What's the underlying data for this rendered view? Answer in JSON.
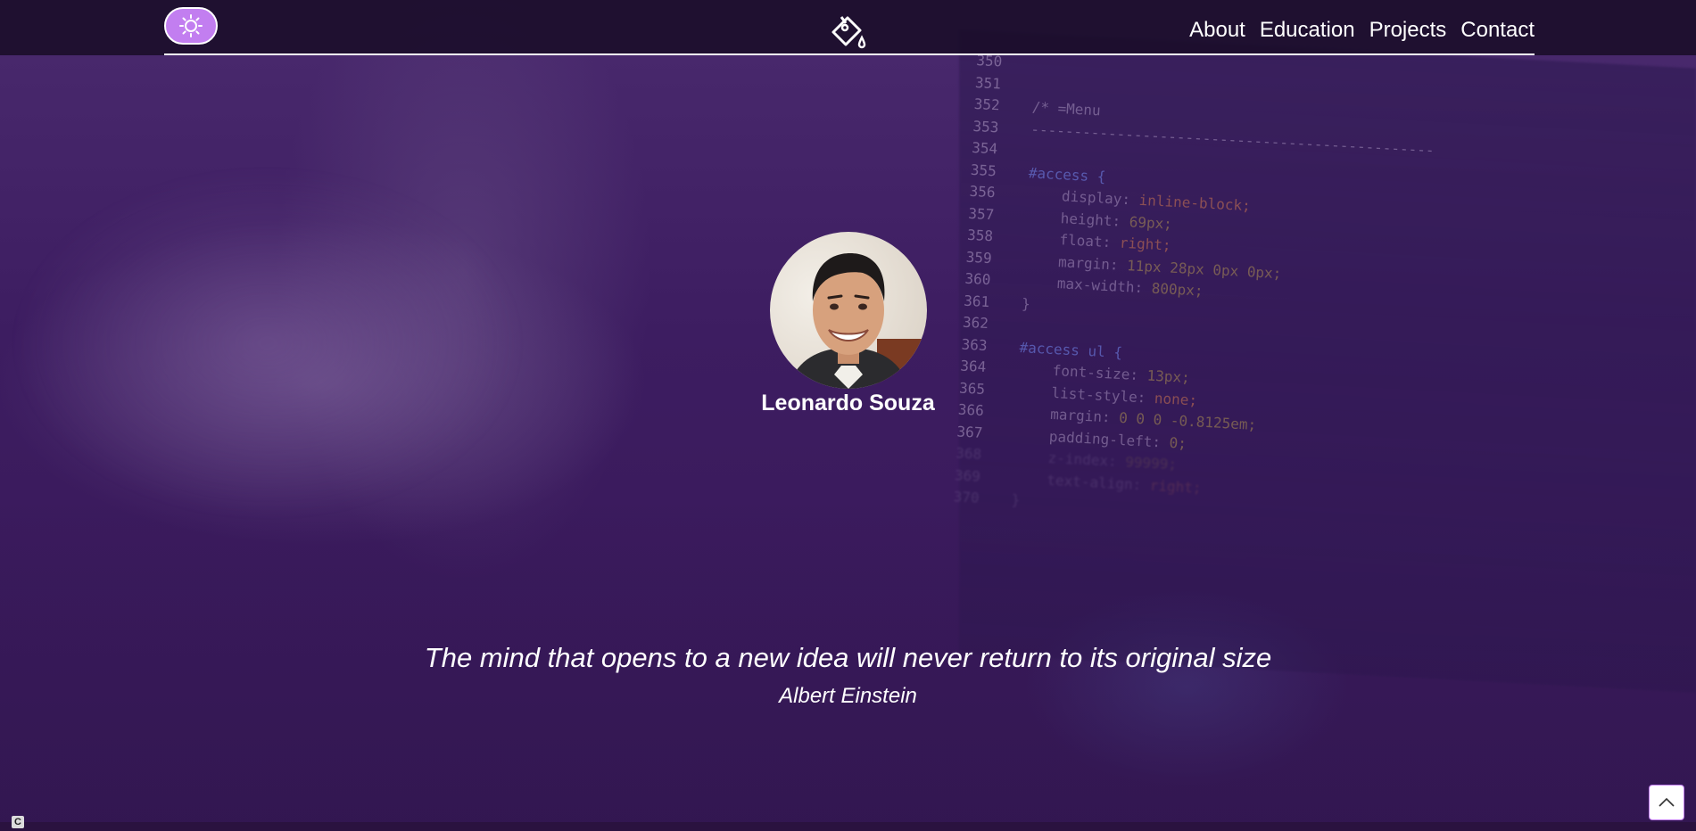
{
  "header": {
    "theme_toggle_icon": "sun-icon",
    "logo_icon": "paint-bucket-icon",
    "nav": [
      {
        "label": "About"
      },
      {
        "label": "Education"
      },
      {
        "label": "Projects"
      },
      {
        "label": "Contact"
      }
    ]
  },
  "profile": {
    "name": "Leonardo Souza"
  },
  "quote": {
    "text": "The mind that opens to a new idea will never return to its original size",
    "author": "Albert Einstein"
  },
  "background_code": [
    {
      "ln": "350",
      "text": ""
    },
    {
      "ln": "351",
      "text": ""
    },
    {
      "ln": "352",
      "text": "/* =Menu"
    },
    {
      "ln": "353",
      "text": "-----------------------------------------------"
    },
    {
      "ln": "354",
      "text": ""
    },
    {
      "ln": "355",
      "text": "#access {"
    },
    {
      "ln": "356",
      "text": "    display: inline-block;"
    },
    {
      "ln": "357",
      "text": "    height: 69px;"
    },
    {
      "ln": "358",
      "text": "    float: right;"
    },
    {
      "ln": "359",
      "text": "    margin: 11px 28px 0px 0px;"
    },
    {
      "ln": "360",
      "text": "    max-width: 800px;"
    },
    {
      "ln": "361",
      "text": "}"
    },
    {
      "ln": "362",
      "text": ""
    },
    {
      "ln": "363",
      "text": "#access ul {"
    },
    {
      "ln": "364",
      "text": "    font-size: 13px;"
    },
    {
      "ln": "365",
      "text": "    list-style: none;"
    },
    {
      "ln": "366",
      "text": "    margin: 0 0 0 -0.8125em;"
    },
    {
      "ln": "367",
      "text": "    padding-left: 0;"
    },
    {
      "ln": "368",
      "text": "    z-index: 99999;"
    },
    {
      "ln": "369",
      "text": "    text-align: right;"
    },
    {
      "ln": "370",
      "text": "}"
    }
  ],
  "back_to_top_icon": "chevron-up-icon",
  "corner_badge": "C",
  "colors": {
    "accent": "#c27ef0",
    "header_bg": "#190c28",
    "page_bg": "#3a1b5c",
    "text": "#ffffff"
  }
}
